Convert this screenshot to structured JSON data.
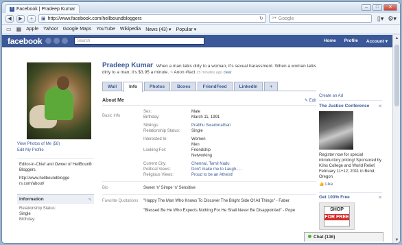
{
  "browser": {
    "tab_title": "Facebook | Pradeep Kumar",
    "url": "http://www.facebook.com/hellboundbloggers",
    "search_placeholder": "Google",
    "bookmarks": [
      "Apple",
      "Yahoo!",
      "Google Maps",
      "YouTube",
      "Wikipedia",
      "News (43) ▾",
      "Popular ▾"
    ]
  },
  "fb": {
    "logo": "facebook",
    "search_placeholder": "Search",
    "nav": [
      "Home",
      "Profile",
      "Account ▾"
    ]
  },
  "left": {
    "view_photos": "View Photos of Me (58)",
    "edit_profile": "Edit My Profile",
    "bio_line1": "Editor-in-Chief and Owner of HellBound Bloggers.",
    "bio_line2": "http://www.hellboundblogge rs.com/about/",
    "info_heading": "Information",
    "rel_label": "Relationship Status:",
    "rel_value": "Single",
    "bday_label": "Birthday:"
  },
  "profile": {
    "name": "Pradeep Kumar",
    "status": "When a man talks dirty to a woman, it's sexual harassment. When a woman talks dirty to a man, it's $3.95 a minute. ~ Anon #fact",
    "status_time": "15 minutes ago",
    "clear": "clear",
    "tabs": [
      "Wall",
      "Info",
      "Photos",
      "Boxes",
      "FriendFeed",
      "LinkedIn",
      "+"
    ]
  },
  "about": {
    "heading": "About Me",
    "edit": "Edit",
    "basic_info_label": "Basic Info",
    "sex_label": "Sex:",
    "sex": "Male",
    "birthday_label": "Birthday:",
    "birthday": "March 11, 1991",
    "siblings_label": "Siblings:",
    "siblings": "Prabhu Swaminathan",
    "rel_label": "Relationship Status:",
    "rel": "Single",
    "interested_label": "Interested In:",
    "interested1": "Women",
    "interested2": "Men",
    "looking_label": "Looking For:",
    "looking1": "Friendship",
    "looking2": "Networking",
    "city_label": "Current City:",
    "city": "Chennai, Tamil Nadu",
    "political_label": "Political Views:",
    "political": "Don't make me to Laugh.....",
    "religious_label": "Religious Views:",
    "religious": "Proud to be an Atheist!",
    "bio_label": "Bio",
    "bio": "Sweet 'n' Simpe 'n' Sensitive",
    "quotes_label": "Favorite Quotations",
    "quote1": "\"Happy The Man Who Knows To Discover The Bright Side Of All Things\" - Faber",
    "quote2": "\"Blessed Be He Who Expects Nothing For He Shall Never Be Disappointed\" - Pope"
  },
  "ads": {
    "create_ad": "Create an Ad",
    "ad1_title": "The Justice Conference",
    "ad1_body": "Register now for special introductory pricing! Sponsored by Kilns College and World Relief, February 11+12, 2011 in Bend, Oregon",
    "like": "Like",
    "ad2_title": "Get 100% Free",
    "ad2_img1": "SHOP",
    "ad2_img2": "FOR FREE"
  },
  "chat": {
    "label": "Chat (136)"
  }
}
